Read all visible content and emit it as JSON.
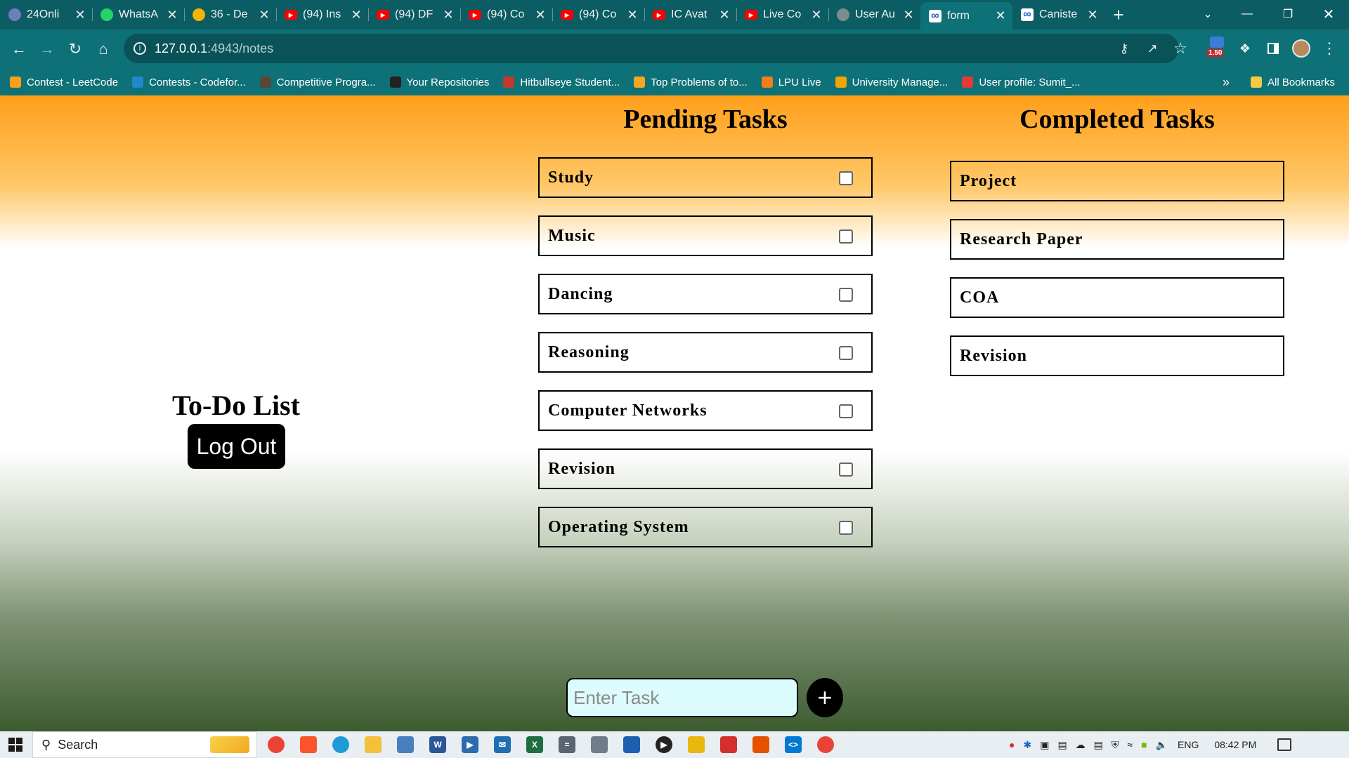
{
  "browser": {
    "tabs": [
      {
        "title": "24Onli",
        "icon": "cloud-icon",
        "color": "#6b7fb8"
      },
      {
        "title": "WhatsA",
        "icon": "whatsapp-icon",
        "color": "#25d366"
      },
      {
        "title": "36 - De",
        "icon": "drive-icon",
        "color": "#f4b400"
      },
      {
        "title": "(94) Ins",
        "icon": "youtube-icon",
        "color": "#ff0000"
      },
      {
        "title": "(94) DF",
        "icon": "youtube-icon",
        "color": "#ff0000"
      },
      {
        "title": "(94) Co",
        "icon": "youtube-icon",
        "color": "#ff0000"
      },
      {
        "title": "(94) Co",
        "icon": "youtube-icon",
        "color": "#ff0000"
      },
      {
        "title": "IC Avat",
        "icon": "youtube-icon",
        "color": "#ff0000"
      },
      {
        "title": "Live Co",
        "icon": "youtube-icon",
        "color": "#ff0000"
      },
      {
        "title": "User Au",
        "icon": "openai-icon",
        "color": "#7a8f8c"
      },
      {
        "title": "form",
        "icon": "infinity-icon",
        "color": "#ffffff",
        "active": true
      },
      {
        "title": "Caniste",
        "icon": "infinity-icon",
        "color": "#ffffff"
      }
    ],
    "address": {
      "host": "127.0.0.1",
      "path": ":4943/notes"
    },
    "extension_badge": "1.50",
    "bookmarks": [
      {
        "label": "Contest - LeetCode",
        "icon": "leetcode-icon",
        "color": "#f89f1b"
      },
      {
        "label": "Contests - Codefor...",
        "icon": "codeforces-icon",
        "color": "#1f8acb"
      },
      {
        "label": "Competitive Progra...",
        "icon": "codechef-icon",
        "color": "#5b4638"
      },
      {
        "label": "Your Repositories",
        "icon": "github-icon",
        "color": "#222222"
      },
      {
        "label": "Hitbullseye Student...",
        "icon": "hitbullseye-icon",
        "color": "#c0392b"
      },
      {
        "label": "Top Problems of to...",
        "icon": "coding-icon",
        "color": "#f5a623"
      },
      {
        "label": "LPU Live",
        "icon": "lpu-icon",
        "color": "#ef7f1a"
      },
      {
        "label": "University Manage...",
        "icon": "ums-icon",
        "color": "#f0a500"
      },
      {
        "label": "User profile: Sumit_...",
        "icon": "profile-icon",
        "color": "#e53935"
      }
    ],
    "bookmarks_overflow": "»",
    "all_bookmarks": "All Bookmarks"
  },
  "app": {
    "title": "To-Do List",
    "logout_label": "Log Out",
    "pending_heading": "Pending Tasks",
    "completed_heading": "Completed Tasks",
    "pending_tasks": [
      "Study",
      "Music",
      "Dancing",
      "Reasoning",
      "Computer Networks",
      "Revision",
      "Operating System"
    ],
    "completed_tasks": [
      "Project",
      "Research Paper",
      "COA",
      "Revision"
    ],
    "input_placeholder": "Enter Task",
    "add_symbol": "+"
  },
  "taskbar": {
    "search_label": "Search",
    "language": "ENG",
    "time": "08:42 PM"
  }
}
